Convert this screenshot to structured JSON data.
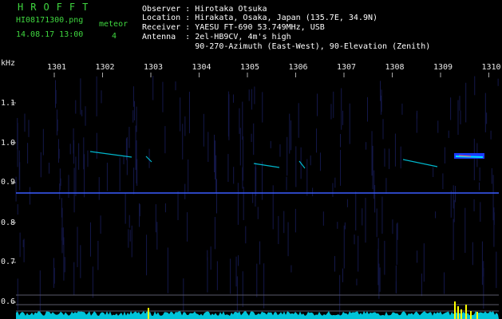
{
  "app": {
    "title": "HROFFT"
  },
  "file": {
    "name": "HI08171300.png",
    "timestamp": "14.08.17 13:00"
  },
  "counter": {
    "label": "meteor",
    "value": "4"
  },
  "station": {
    "observer": "Observer : Hirotaka Otsuka",
    "location": "Location : Hirakata, Osaka, Japan (135.7E, 34.9N)",
    "receiver": "Receiver : YAESU FT-690 53.749MHz, USB",
    "antenna": "Antenna  : 2el-HB9CV, 4m's high",
    "antenna2": "           90-270-Azimuth (East-West), 90-Elevation (Zenith)"
  },
  "axis": {
    "unit": "kHz",
    "x_ticks": [
      "1301",
      "1302",
      "1303",
      "1304",
      "1305",
      "1306",
      "1307",
      "1308",
      "1309",
      "1310"
    ],
    "y_ticks": [
      "1.1",
      "1.0",
      "0.9",
      "0.8",
      "0.7",
      "0.6"
    ]
  },
  "colors": {
    "title": "#3fd63f",
    "carrier": "#3a5cff",
    "signal": "#00e5ff",
    "peak": "#ffff00"
  }
}
